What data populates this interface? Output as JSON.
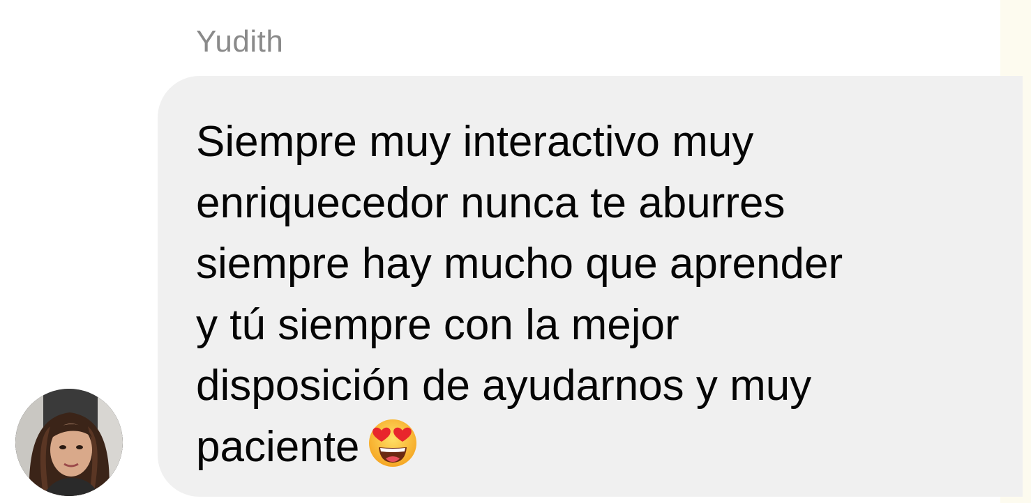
{
  "message": {
    "sender_name": "Yudith",
    "text_lines": [
      "Siempre muy interactivo muy",
      "enriquecedor nunca te aburres",
      "siempre hay mucho que aprender",
      "y tú siempre con la mejor",
      "disposición de ayudarnos y muy",
      "paciente"
    ],
    "emoji": "smiling-face-with-heart-eyes-icon"
  },
  "avatar": {
    "icon": "user-avatar"
  },
  "colors": {
    "bubble_background": "#f0f0f0",
    "sender_name": "#8a8a8a",
    "message_text": "#050505",
    "background": "#ffffff"
  }
}
